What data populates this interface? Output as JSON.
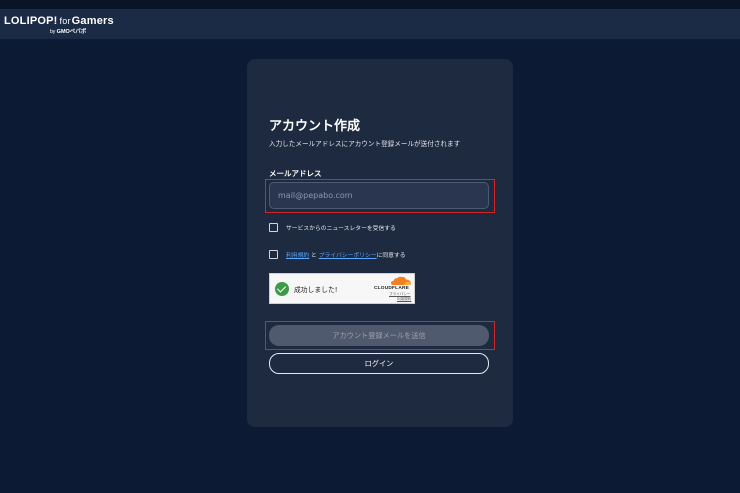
{
  "header": {
    "logo_main": "LOLIPOP!",
    "logo_for": "for",
    "logo_gamers": "Gamers",
    "logo_by": "by",
    "logo_gmo": "GMOペパボ"
  },
  "card": {
    "title": "アカウント作成",
    "subtitle": "入力したメールアドレスにアカウント登録メールが送付されます",
    "email_label": "メールアドレス",
    "email_placeholder": "mail@pepabo.com",
    "email_value": "",
    "newsletter_label": "サービスからのニュースレターを受信する",
    "newsletter_checked": false,
    "terms": {
      "checked": false,
      "link1": "利用規約",
      "conj": "と",
      "link2": "プライバシーポリシー",
      "suffix": "に同意する"
    },
    "captcha": {
      "status": "成功しました!",
      "brand": "CLOUDFLARE",
      "privacy": "プライバシー",
      "terms": "利用規約"
    },
    "submit_label": "アカウント登録メールを送信",
    "login_label": "ログイン"
  },
  "colors": {
    "page_bg": "#0d1a33",
    "card_bg": "#1e2a3f",
    "highlight": "#d42424",
    "link": "#5aa9ff",
    "success": "#3d9a47",
    "cloudflare_orange": "#f38020"
  },
  "icons": [
    "checkbox-icon",
    "check-circle-icon",
    "cloudflare-cloud-icon"
  ]
}
